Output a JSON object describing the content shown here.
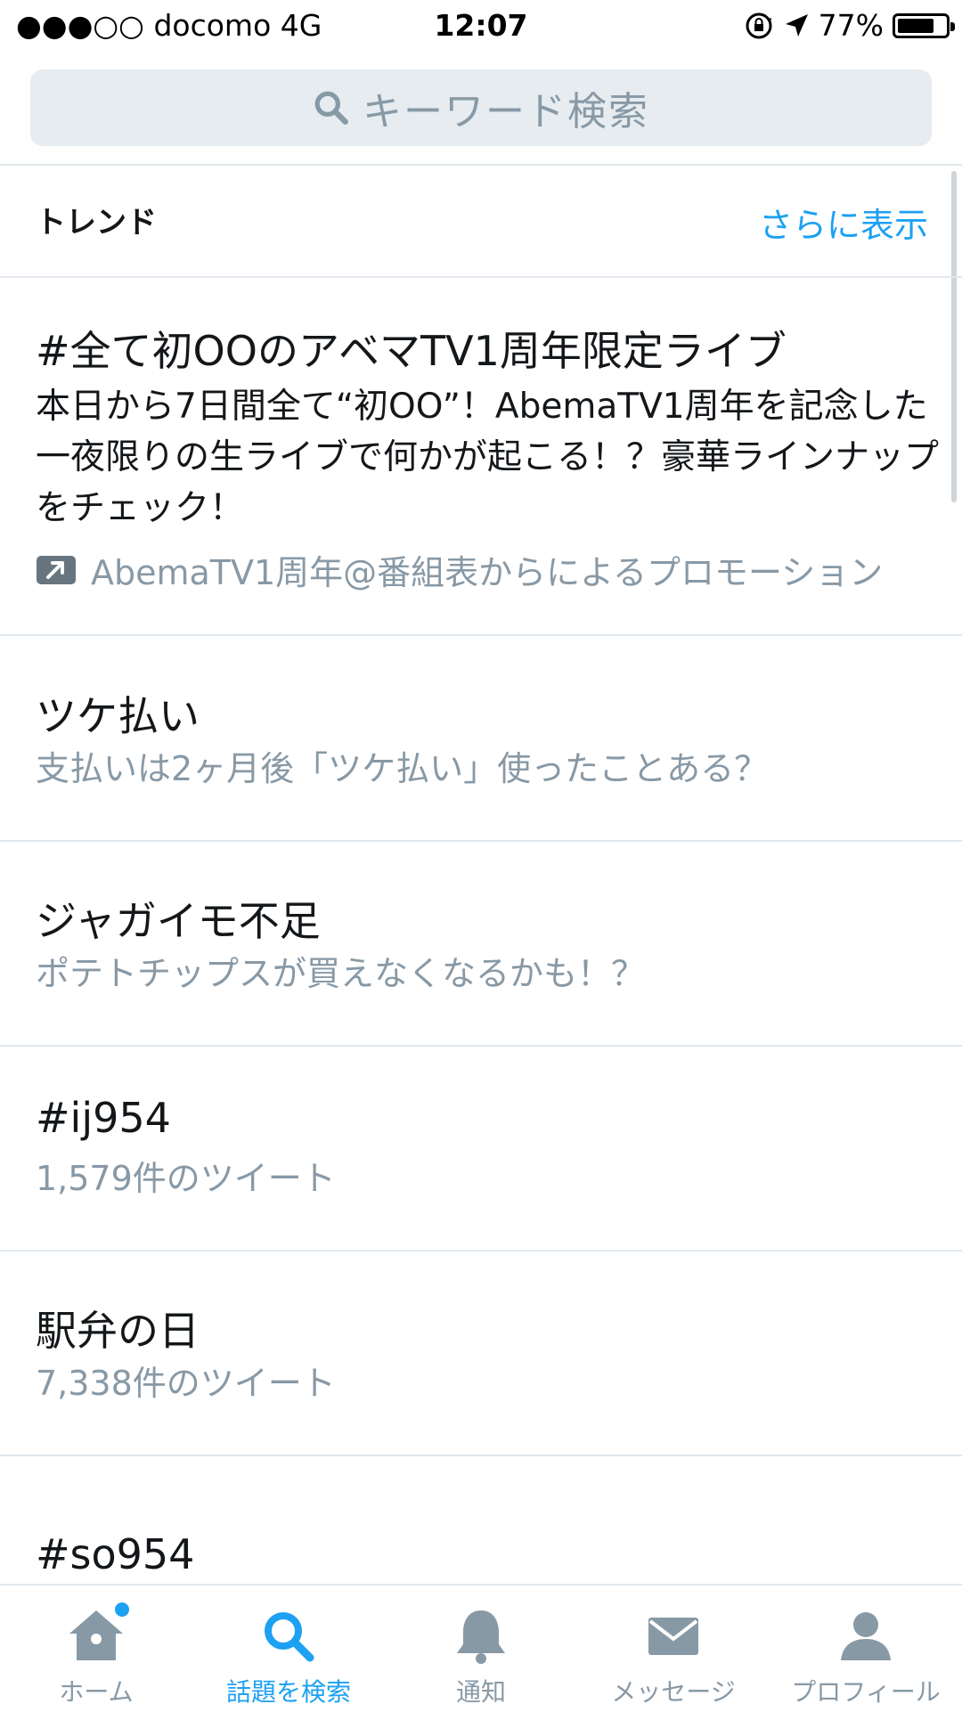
{
  "status_bar": {
    "carrier": "●●●○○ docomo   4G",
    "time": "12:07",
    "battery": "77%",
    "battery_level": 0.77
  },
  "search": {
    "placeholder": "キーワード検索"
  },
  "trends": {
    "title": "トレンド",
    "more_label": "さらに表示",
    "items": [
      {
        "name": "#全て初OOのアベマTV1周年限定ライブ",
        "description": "本日から7日間全て“初OO”！AbemaTV1周年を記念した一夜限りの生ライブで何かが起こる！？豪華ラインナップをチェック！",
        "promoted_by": "AbemaTV1周年@番組表からによるプロモーション"
      },
      {
        "name": "ツケ払い",
        "description": "支払いは2ヶ月後「ツケ払い」使ったことある？"
      },
      {
        "name": "ジャガイモ不足",
        "description": "ポテトチップスが買えなくなるかも！？"
      },
      {
        "name": "#ij954",
        "description": "1,579件のツイート"
      },
      {
        "name": "駅弁の日",
        "description": "7,338件のツイート"
      },
      {
        "name": "#so954"
      }
    ]
  },
  "tab_bar": {
    "tabs": [
      {
        "label": "ホーム",
        "icon": "home-icon"
      },
      {
        "label": "話題を検索",
        "icon": "search-icon",
        "active": true
      },
      {
        "label": "通知",
        "icon": "bell-icon"
      },
      {
        "label": "メッセージ",
        "icon": "envelope-icon"
      },
      {
        "label": "プロフィール",
        "icon": "person-icon"
      }
    ]
  },
  "colors": {
    "accent": "#1da1f2",
    "secondary_text": "#8899a6",
    "search_bg": "#e6ecf0",
    "divider": "#e1e8ed"
  }
}
